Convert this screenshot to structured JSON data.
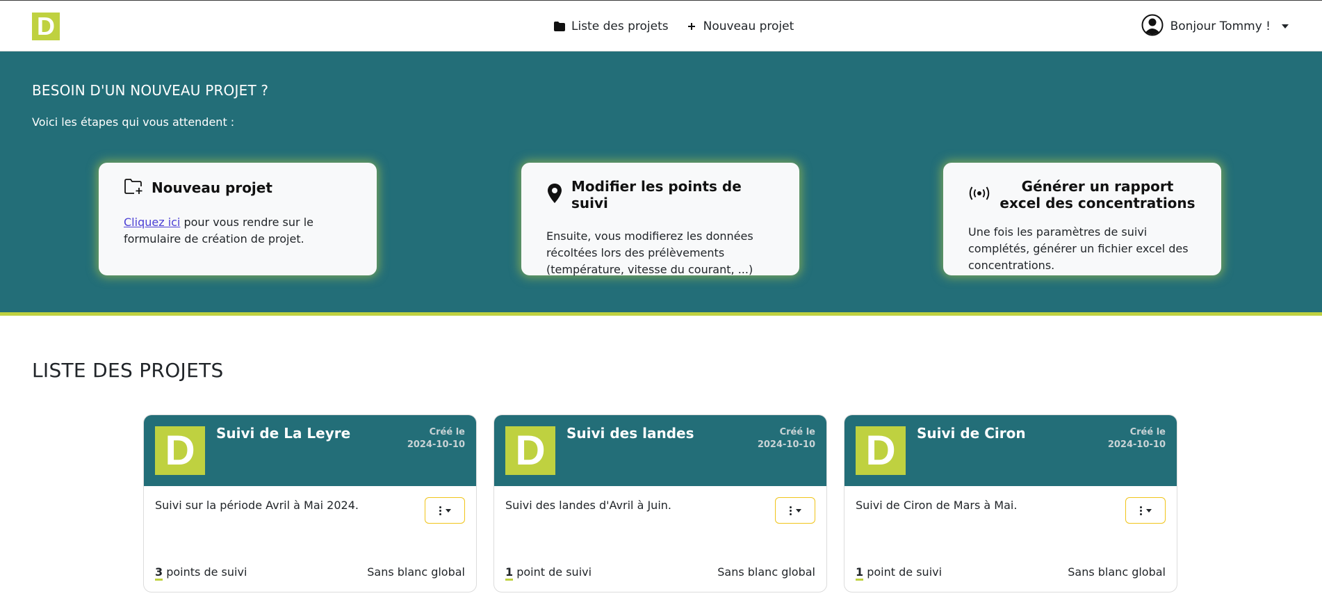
{
  "navbar": {
    "logo_letter": "D",
    "links": [
      {
        "label": "Liste des projets",
        "icon": "folder-icon"
      },
      {
        "label": "Nouveau projet",
        "icon": "plus-icon"
      }
    ],
    "user_greeting": "Bonjour Tommy !"
  },
  "hero": {
    "title": "BESOIN D'UN NOUVEAU PROJET ?",
    "subtitle": "Voici les étapes qui vous attendent :",
    "steps": [
      {
        "icon": "folder-plus-icon",
        "title": "Nouveau projet",
        "link_text": "Cliquez ici",
        "body": " pour vous rendre sur le formulaire de création de projet."
      },
      {
        "icon": "map-pin-icon",
        "title": "Modifier les points de suivi",
        "body": "Ensuite, vous modifierez les données récoltées lors des prélèvements (température, vitesse du courant, ...)"
      },
      {
        "icon": "broadcast-icon",
        "title": "Générer un rapport excel des concentrations",
        "body": "Une fois les paramètres de suivi complétés, générer un fichier excel des concentrations."
      }
    ]
  },
  "projects": {
    "title": "LISTE DES PROJETS",
    "items": [
      {
        "logo_letter": "D",
        "name": "Suivi de La Leyre",
        "created_label": "Créé le",
        "created_date": "2024-10-10",
        "description": "Suivi sur la période Avril à Mai 2024.",
        "points_count": "3",
        "points_label": "points de suivi",
        "blank": "Sans blanc global"
      },
      {
        "logo_letter": "D",
        "name": "Suivi des landes",
        "created_label": "Créé le",
        "created_date": "2024-10-10",
        "description": "Suivi des landes d'Avril à Juin.",
        "points_count": "1",
        "points_label": "point de suivi",
        "blank": "Sans blanc global"
      },
      {
        "logo_letter": "D",
        "name": "Suivi de Ciron",
        "created_label": "Créé le",
        "created_date": "2024-10-10",
        "description": "Suivi de Ciron de Mars à Mai.",
        "points_count": "1",
        "points_label": "point de suivi",
        "blank": "Sans blanc global"
      }
    ]
  },
  "colors": {
    "teal": "#236e78",
    "lime": "#bfd140",
    "menu_border": "#f0c419"
  }
}
